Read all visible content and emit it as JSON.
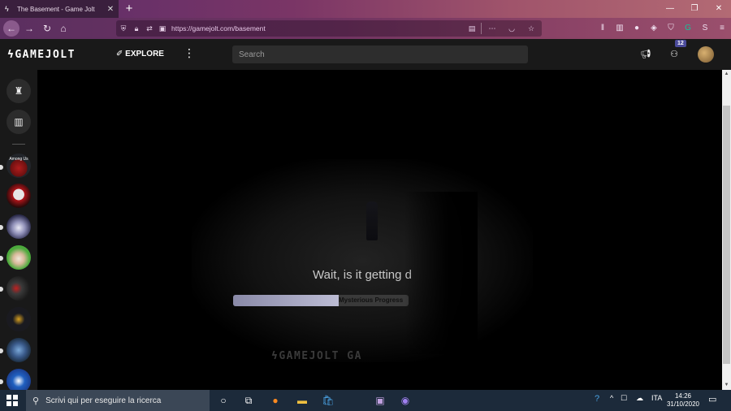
{
  "browser": {
    "tab_title": "The Basement - Game Jolt",
    "tab_close": "✕",
    "new_tab": "+",
    "url": "https://gamejolt.com/basement",
    "window_controls": {
      "minimize": "—",
      "restore": "❐",
      "close": "✕"
    }
  },
  "gj_header": {
    "logo": "ϟGAMEJOLT",
    "explore_label": "EXPLORE",
    "explore_icon": "✐",
    "more": "⋮",
    "search_placeholder": "Search",
    "notification_count": "12"
  },
  "sidebar": {
    "communities": [
      "Among Us",
      "Community 2",
      "Community 3",
      "Community 4",
      "Community 5",
      "Community 6",
      "Community 7",
      "Community 8"
    ]
  },
  "main": {
    "wait_text": "Wait, is it getting d",
    "progress_label": "Mysterious Progress",
    "progress_fraction": 0.6,
    "footer_logo": "ϟGAMEJOLT GA"
  },
  "taskbar": {
    "search_placeholder": "Scrivi qui per eseguire la ricerca",
    "language": "ITA",
    "time": "14:26",
    "date": "31/10/2020"
  },
  "colors": {
    "accent_purple": "#4a4a9a",
    "progress_fill": "#bcbcd4",
    "header_bg": "#191919"
  }
}
